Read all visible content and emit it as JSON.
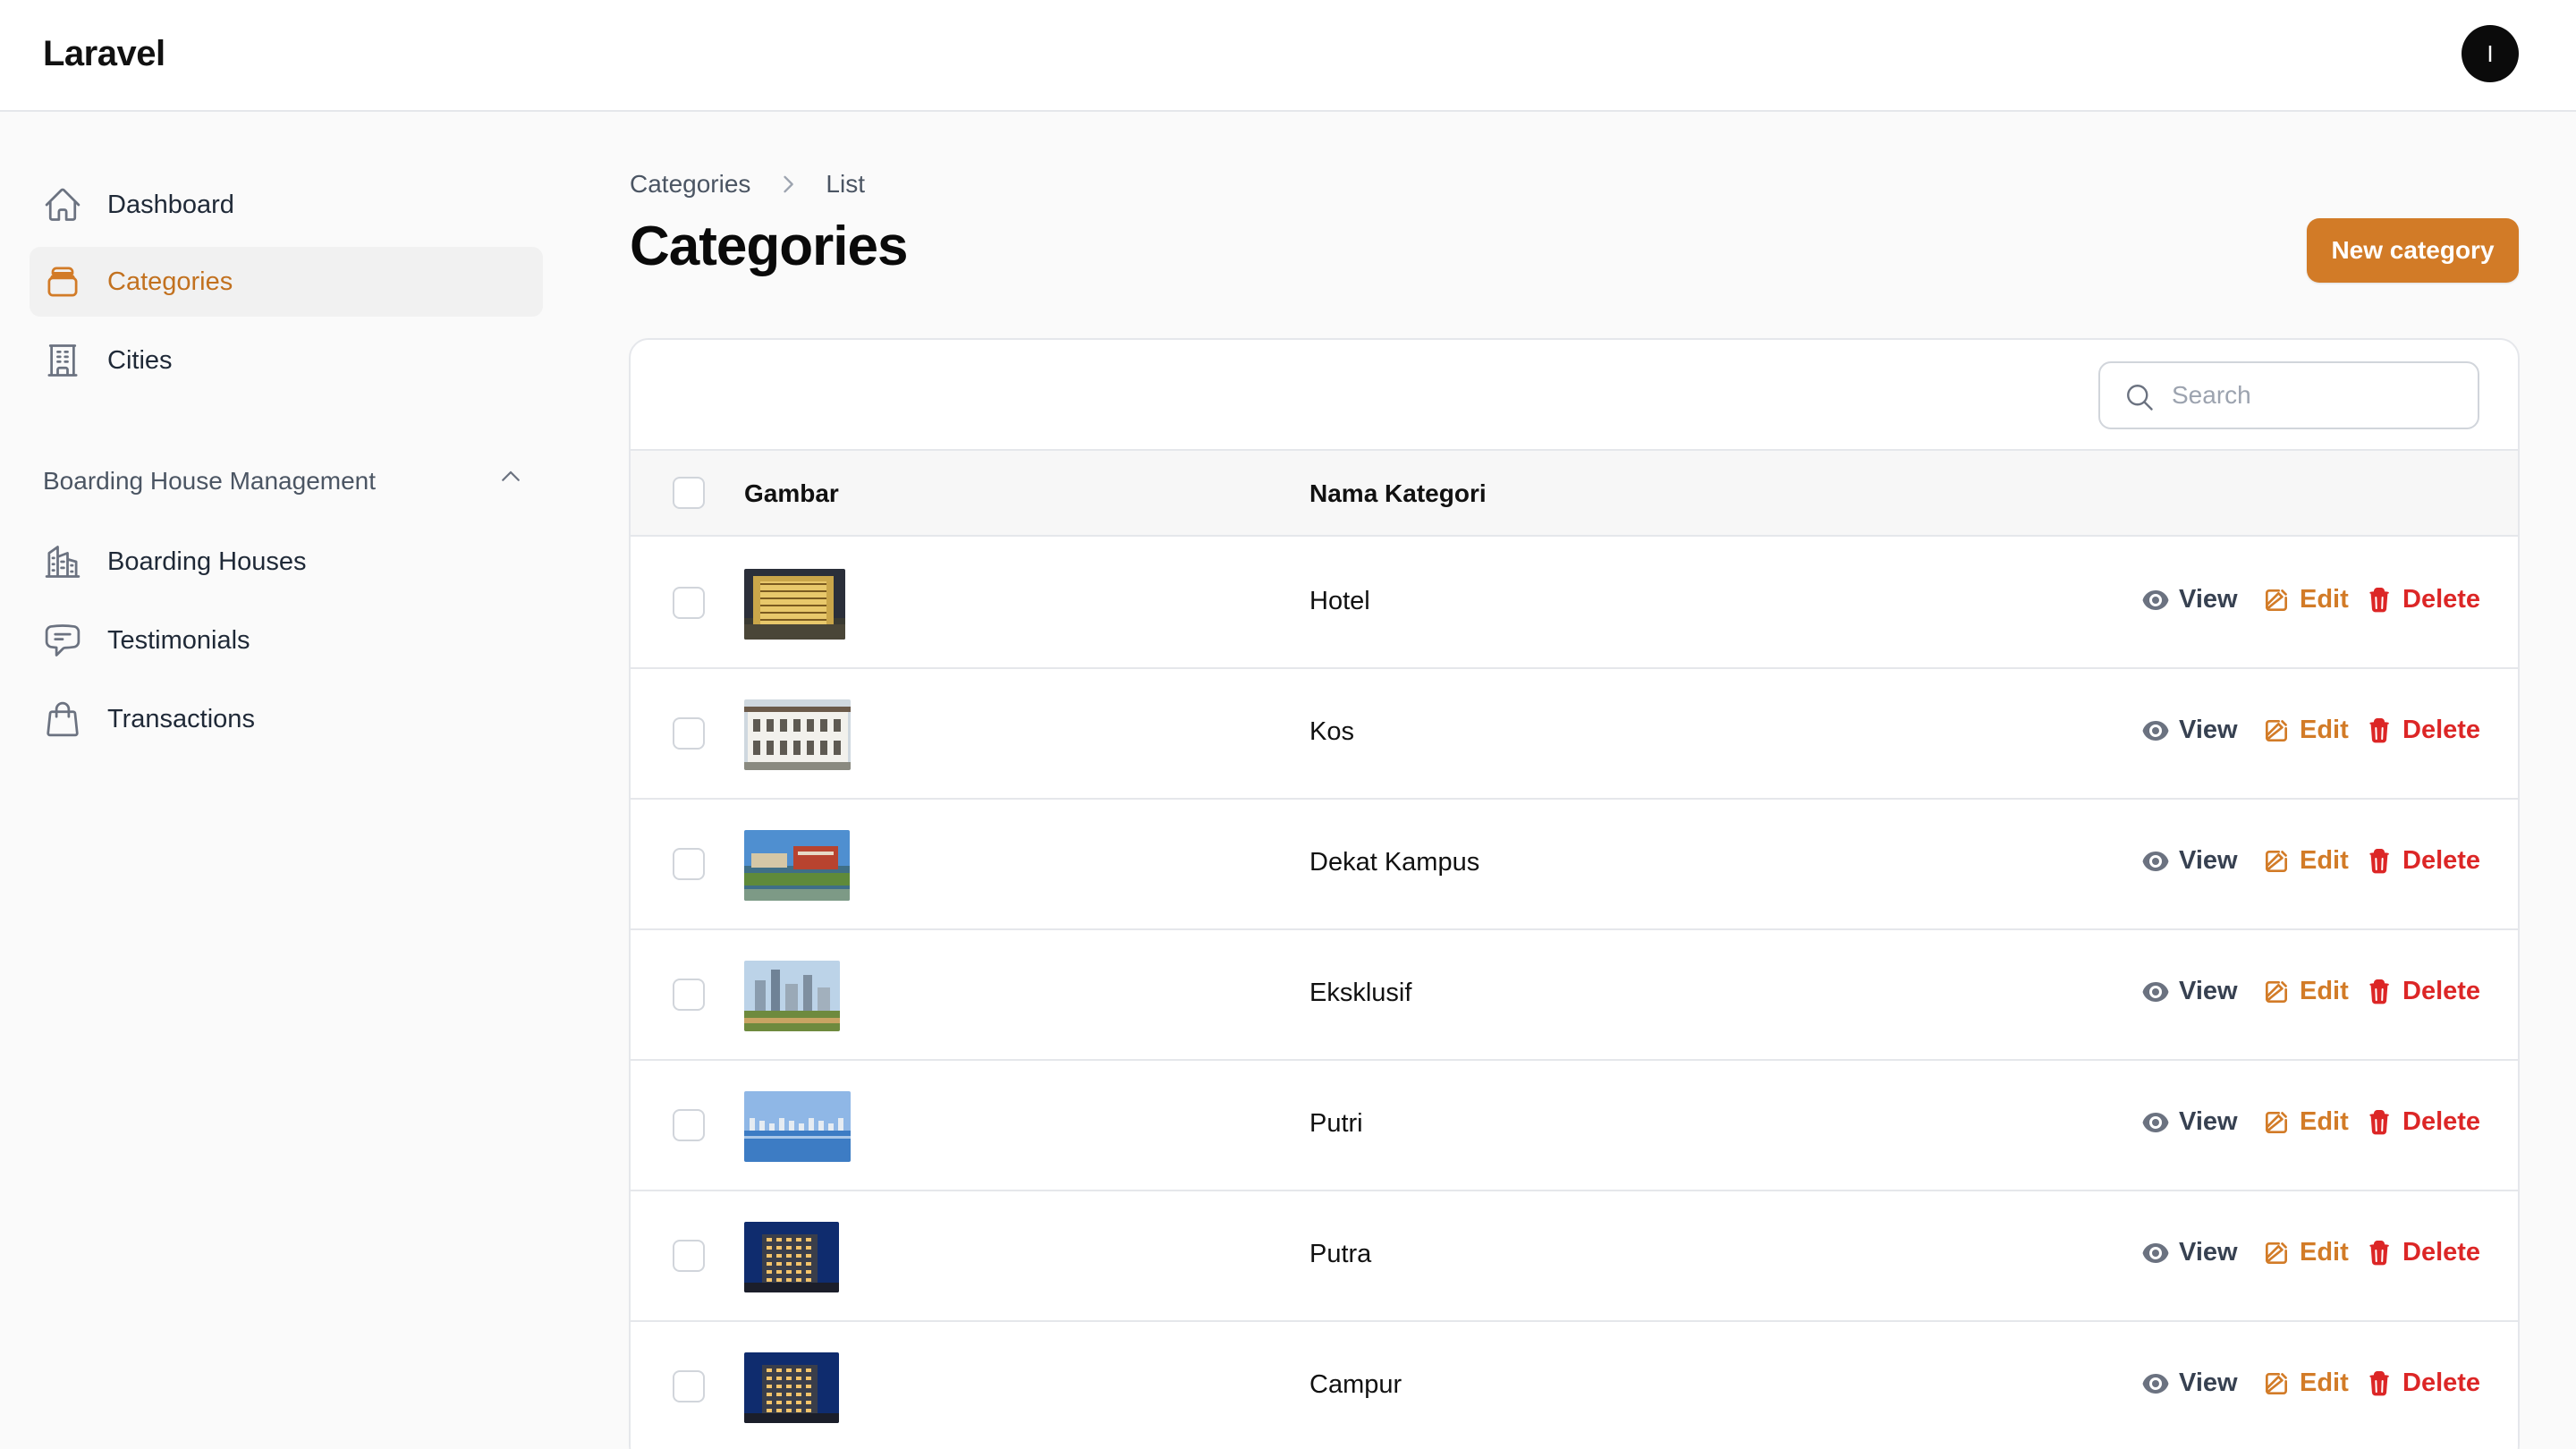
{
  "app": {
    "brand": "Laravel",
    "user_initial": "I"
  },
  "sidebar": {
    "items": [
      {
        "label": "Dashboard",
        "icon": "home-icon"
      },
      {
        "label": "Categories",
        "icon": "rectangle-stack-icon",
        "active": true
      },
      {
        "label": "Cities",
        "icon": "building-office-icon"
      }
    ],
    "group": {
      "label": "Boarding House Management",
      "items": [
        {
          "label": "Boarding Houses",
          "icon": "building-library-icon"
        },
        {
          "label": "Testimonials",
          "icon": "chat-bubble-icon"
        },
        {
          "label": "Transactions",
          "icon": "shopping-bag-icon"
        }
      ]
    }
  },
  "breadcrumb": {
    "parent": "Categories",
    "current": "List"
  },
  "page": {
    "title": "Categories",
    "new_button": "New category"
  },
  "search": {
    "placeholder": "Search",
    "value": ""
  },
  "table": {
    "columns": {
      "image": "Gambar",
      "name": "Nama Kategori"
    },
    "actions": {
      "view": "View",
      "edit": "Edit",
      "delete": "Delete"
    },
    "rows": [
      {
        "name": "Hotel",
        "image": "hotel-building-photo"
      },
      {
        "name": "Kos",
        "image": "white-row-house-photo"
      },
      {
        "name": "Dekat Kampus",
        "image": "campus-lakeside-photo"
      },
      {
        "name": "Eksklusif",
        "image": "city-skyline-photo"
      },
      {
        "name": "Putri",
        "image": "harbor-skyline-photo"
      },
      {
        "name": "Putra",
        "image": "apartment-night-photo"
      },
      {
        "name": "Campur",
        "image": "apartment-night-photo"
      }
    ]
  },
  "colors": {
    "accent": "#d27b27",
    "danger": "#dc2626",
    "active_bg": "#f1f1f1",
    "background": "#fafafa"
  }
}
